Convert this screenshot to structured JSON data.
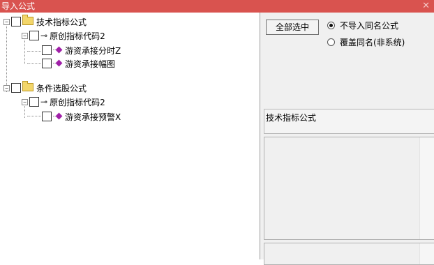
{
  "window": {
    "title": "导入公式",
    "close_glyph": "✕"
  },
  "tree": {
    "expander_expanded": "−",
    "groups": [
      {
        "label": "技术指标公式",
        "icon": "folder-icon",
        "children": [
          {
            "label": "原创指标代码2",
            "icon": "key-icon",
            "children": [
              {
                "label": "游资承接分时Z",
                "icon": "formula-icon"
              },
              {
                "label": "游资承接幅图",
                "icon": "formula-icon"
              }
            ]
          }
        ]
      },
      {
        "label": "条件选股公式",
        "icon": "folder-icon",
        "children": [
          {
            "label": "原创指标代码2",
            "icon": "key-icon",
            "children": [
              {
                "label": "游资承接预警X",
                "icon": "formula-icon"
              }
            ]
          }
        ]
      }
    ]
  },
  "right_panel": {
    "select_all_label": "全部选中",
    "radio_options": [
      {
        "label": "不导入同名公式",
        "checked": true
      },
      {
        "label": "覆盖同名(非系统)",
        "checked": false
      }
    ],
    "category_label": "技术指标公式"
  },
  "colors": {
    "titlebar": "#d9534f",
    "formula_gem": "#a020a8",
    "folder": "#f3d66a"
  }
}
